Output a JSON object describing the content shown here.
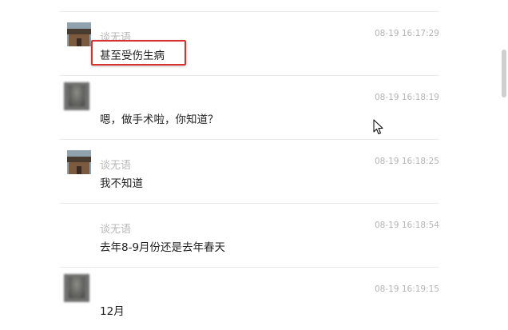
{
  "messages": [
    {
      "sender": "谈无语",
      "time": "08-19 16:17:29",
      "content": "甚至受伤生病",
      "highlighted": true,
      "avatar": "temple-photo"
    },
    {
      "sender": "",
      "time": "08-19 16:18:19",
      "content": "嗯，做手术啦，你知道？",
      "avatar": "blurred"
    },
    {
      "sender": "谈无语",
      "time": "08-19 16:18:25",
      "content": "我不知道",
      "avatar": "temple-photo"
    },
    {
      "sender": "谈无语",
      "time": "08-19 16:18:54",
      "content": "去年8-9月份还是去年春天",
      "avatar": "none"
    },
    {
      "sender": "",
      "time": "08-19 16:19:15",
      "content": "12月",
      "avatar": "blurred"
    }
  ],
  "colors": {
    "highlight_border": "#d9312e",
    "sender": "#b8b8b8",
    "time": "#b4b4b4",
    "content": "#222222",
    "divider": "#ececec"
  },
  "icons": {
    "cursor": "mouse-pointer-icon"
  }
}
